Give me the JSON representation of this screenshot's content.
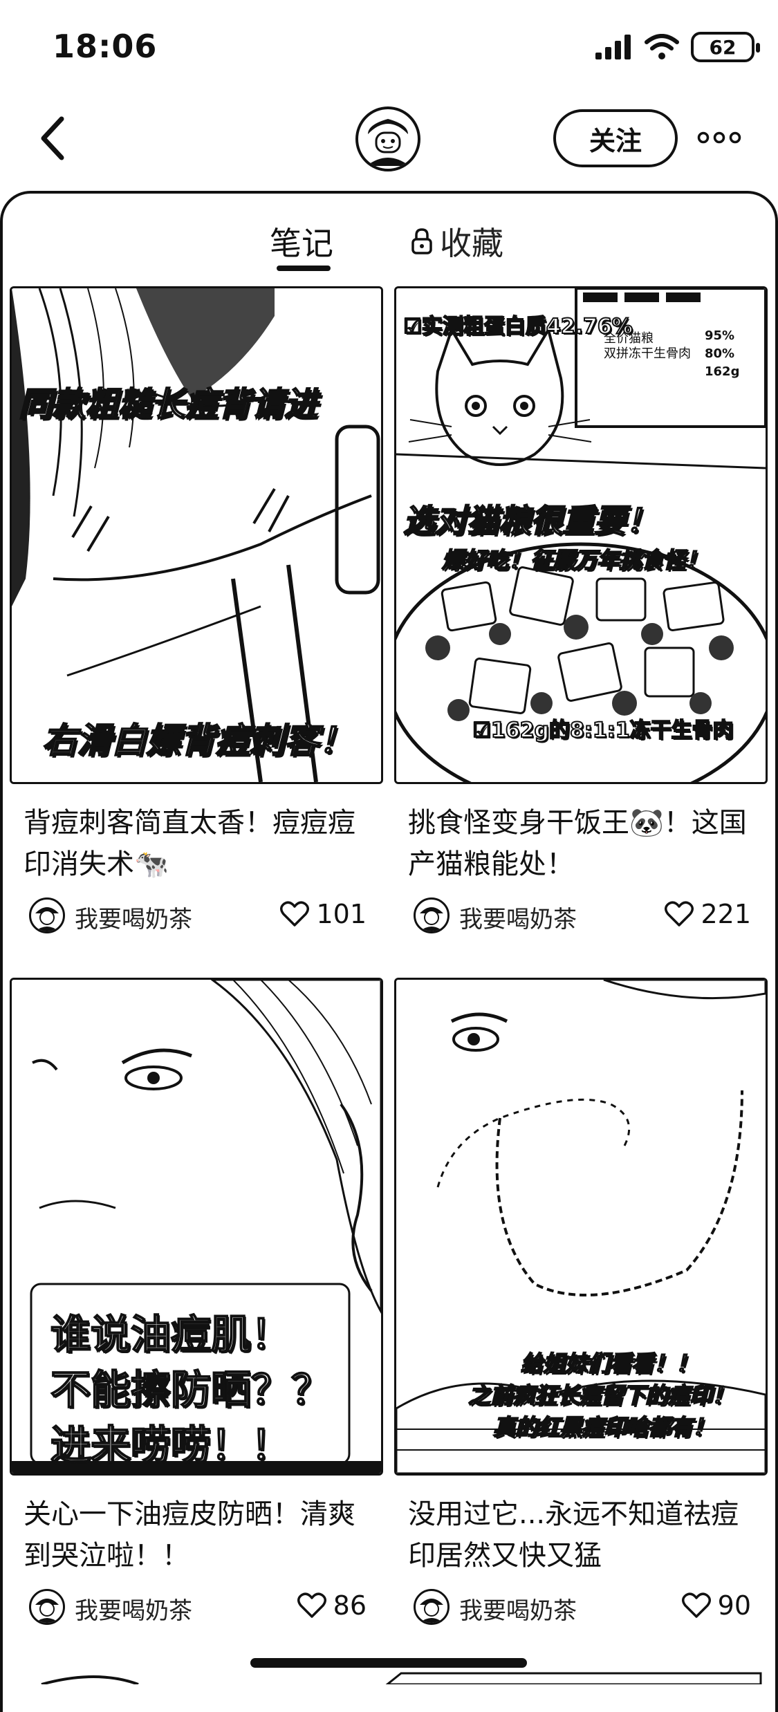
{
  "status_bar": {
    "time": "18:06",
    "battery": "62"
  },
  "header": {
    "follow_label": "关注"
  },
  "tabs": {
    "notes": "笔记",
    "collect": "收藏"
  },
  "notes": [
    {
      "title": "背痘刺客简直太香！痘痘痘印消失术🐄",
      "author": "我要喝奶茶",
      "likes": "101",
      "overlays": [
        "同款粗糙长痘背请进",
        "右滑白嫖背痘刺客！"
      ]
    },
    {
      "title": "挑食怪变身干饭王🐼！这国产猫粮能处！",
      "author": "我要喝奶茶",
      "likes": "221",
      "overlays": [
        "☑实测粗蛋白质42.76%",
        "选对猫粮很重要！",
        "爆好吃！征服万年挑食怪！",
        "☑162g的8:1:1冻干生骨肉"
      ],
      "package": {
        "line1": "全价猫粮",
        "line2": "双拼冻干生骨肉",
        "p1": "95%",
        "p2": "80%",
        "weight": "162g"
      }
    },
    {
      "title": "关心一下油痘皮防晒！清爽到哭泣啦！！",
      "author": "我要喝奶茶",
      "likes": "86",
      "overlays": [
        "谁说油痘肌！",
        "不能擦防晒？？",
        "进来唠唠！！"
      ]
    },
    {
      "title": "没用过它...永远不知道祛痘印居然又快又猛",
      "author": "我要喝奶茶",
      "likes": "90",
      "overlays": [
        "给姐妹们看看！！",
        "之前疯狂长痘留下的痘印！",
        "真的红黑痘印啥都有！"
      ]
    }
  ]
}
